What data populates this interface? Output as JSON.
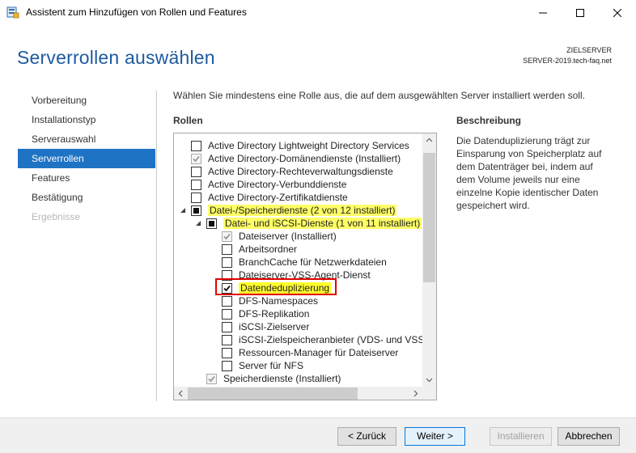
{
  "window": {
    "title": "Assistent zum Hinzufügen von Rollen und Features"
  },
  "header": {
    "page_title": "Serverrollen auswählen",
    "target_label": "ZIELSERVER",
    "target_name": "SERVER-2019.tech-faq.net"
  },
  "nav": {
    "items": [
      {
        "label": "Vorbereitung",
        "state": "normal"
      },
      {
        "label": "Installationstyp",
        "state": "normal"
      },
      {
        "label": "Serverauswahl",
        "state": "normal"
      },
      {
        "label": "Serverrollen",
        "state": "active"
      },
      {
        "label": "Features",
        "state": "normal"
      },
      {
        "label": "Bestätigung",
        "state": "normal"
      },
      {
        "label": "Ergebnisse",
        "state": "disabled"
      }
    ]
  },
  "main": {
    "intro": "Wählen Sie mindestens eine Rolle aus, die auf dem ausgewählten Server installiert werden soll.",
    "roles_heading": "Rollen",
    "roles": [
      {
        "label": "Active Directory Lightweight Directory Services",
        "level": 0,
        "state": "unchecked"
      },
      {
        "label": "Active Directory-Domänendienste (Installiert)",
        "level": 0,
        "state": "gray-checked"
      },
      {
        "label": "Active Directory-Rechteverwaltungsdienste",
        "level": 0,
        "state": "unchecked"
      },
      {
        "label": "Active Directory-Verbunddienste",
        "level": 0,
        "state": "unchecked"
      },
      {
        "label": "Active Directory-Zertifikatdienste",
        "level": 0,
        "state": "unchecked"
      },
      {
        "label": "Datei-/Speicherdienste (2 von 12 installiert)",
        "level": 0,
        "state": "partial",
        "expander": "expanded",
        "highlight": "yellow"
      },
      {
        "label": "Datei- und iSCSI-Dienste (1 von 11 installiert)",
        "level": 1,
        "state": "partial",
        "expander": "expanded",
        "highlight": "yellow"
      },
      {
        "label": "Dateiserver (Installiert)",
        "level": 2,
        "state": "gray-checked"
      },
      {
        "label": "Arbeitsordner",
        "level": 2,
        "state": "unchecked"
      },
      {
        "label": "BranchCache für Netzwerkdateien",
        "level": 2,
        "state": "unchecked"
      },
      {
        "label": "Dateiserver-VSS-Agent-Dienst",
        "level": 2,
        "state": "unchecked"
      },
      {
        "label": "Datendeduplizierung",
        "level": 2,
        "state": "checked",
        "highlight": "green"
      },
      {
        "label": "DFS-Namespaces",
        "level": 2,
        "state": "unchecked"
      },
      {
        "label": "DFS-Replikation",
        "level": 2,
        "state": "unchecked"
      },
      {
        "label": "iSCSI-Zielserver",
        "level": 2,
        "state": "unchecked"
      },
      {
        "label": "iSCSI-Zielspeicheranbieter (VDS- und VSS-H",
        "level": 2,
        "state": "unchecked"
      },
      {
        "label": "Ressourcen-Manager für Dateiserver",
        "level": 2,
        "state": "unchecked"
      },
      {
        "label": "Server für NFS",
        "level": 2,
        "state": "unchecked"
      },
      {
        "label": "Speicherdienste (Installiert)",
        "level": 1,
        "state": "gray-checked"
      }
    ],
    "description_heading": "Beschreibung",
    "description": "Die Datenduplizierung trägt zur Einsparung von Speicherplatz auf dem Datenträger bei, indem auf dem Volume jeweils nur eine einzelne Kopie identischer Daten gespeichert wird."
  },
  "footer": {
    "back_label": "< Zurück",
    "next_label": "Weiter >",
    "install_label": "Installieren",
    "cancel_label": "Abbrechen"
  },
  "colors": {
    "accent": "#1f73c4",
    "title": "#1e5aa0",
    "highlight": "#ffff66",
    "marker": "#e00000"
  }
}
